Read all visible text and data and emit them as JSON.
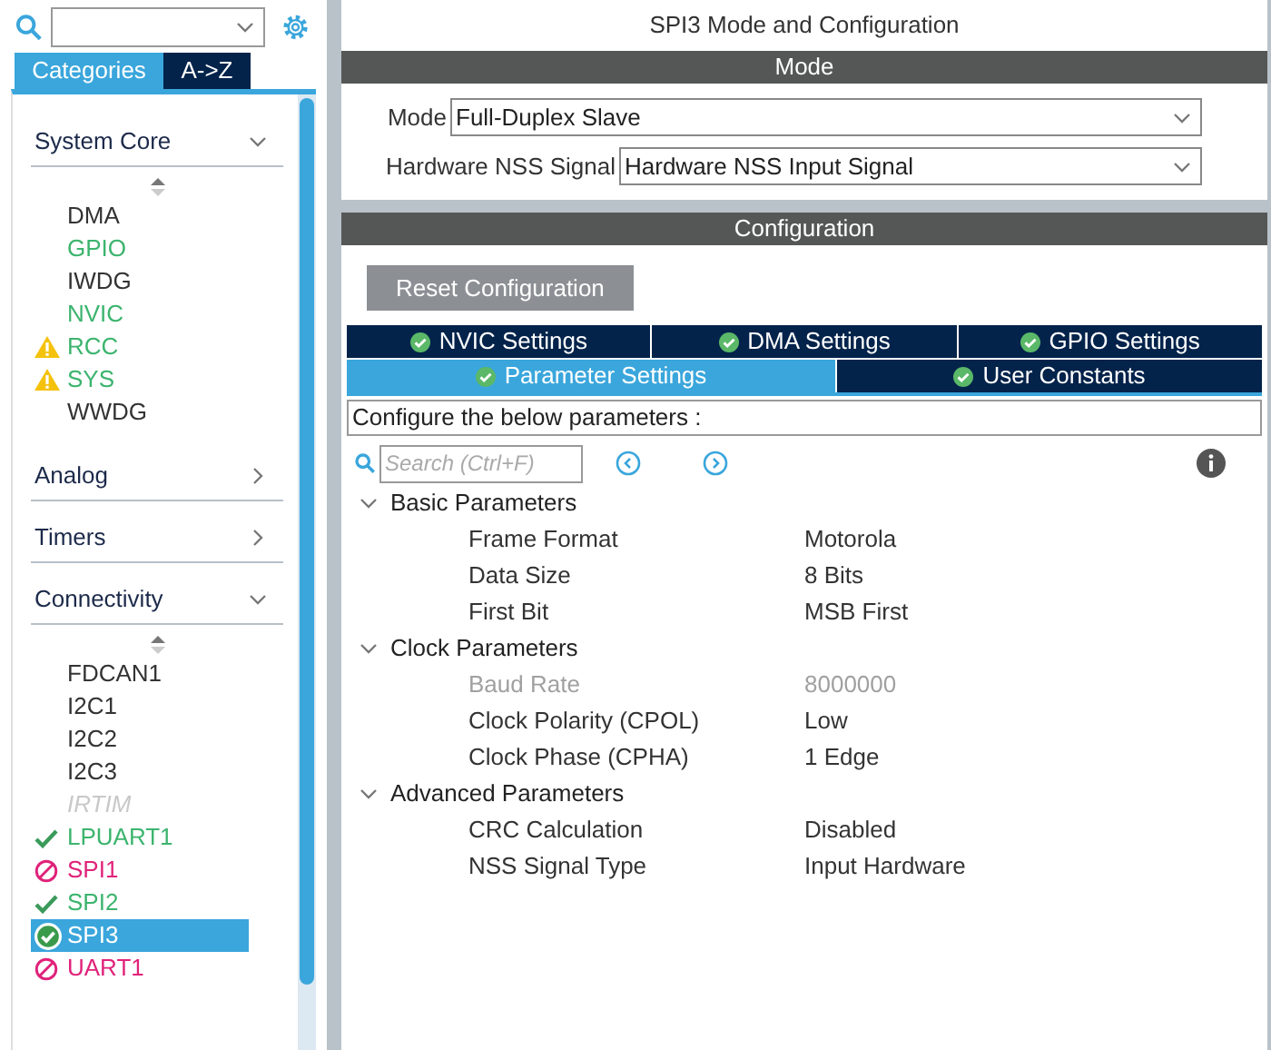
{
  "sidebar": {
    "view_tabs": [
      {
        "label": "Categories",
        "selected": true
      },
      {
        "label": "A->Z",
        "selected": false
      }
    ],
    "categories": [
      {
        "label": "System Core",
        "expanded": true,
        "items": [
          {
            "label": "DMA",
            "kind": "none",
            "selected": false
          },
          {
            "label": "GPIO",
            "kind": "configured",
            "selected": false
          },
          {
            "label": "IWDG",
            "kind": "none",
            "selected": false
          },
          {
            "label": "NVIC",
            "kind": "configured",
            "selected": false
          },
          {
            "label": "RCC",
            "kind": "warning",
            "selected": false
          },
          {
            "label": "SYS",
            "kind": "warning",
            "selected": false
          },
          {
            "label": "WWDG",
            "kind": "none",
            "selected": false
          }
        ]
      },
      {
        "label": "Analog",
        "expanded": false
      },
      {
        "label": "Timers",
        "expanded": false
      },
      {
        "label": "Connectivity",
        "expanded": true,
        "items": [
          {
            "label": "FDCAN1",
            "kind": "none",
            "selected": false
          },
          {
            "label": "I2C1",
            "kind": "none",
            "selected": false
          },
          {
            "label": "I2C2",
            "kind": "none",
            "selected": false
          },
          {
            "label": "I2C3",
            "kind": "none",
            "selected": false
          },
          {
            "label": "IRTIM",
            "kind": "disabled",
            "selected": false
          },
          {
            "label": "LPUART1",
            "kind": "ok",
            "selected": false
          },
          {
            "label": "SPI1",
            "kind": "error",
            "selected": false
          },
          {
            "label": "SPI2",
            "kind": "ok",
            "selected": false
          },
          {
            "label": "SPI3",
            "kind": "ok",
            "selected": true
          },
          {
            "label": "UART1",
            "kind": "error",
            "selected": false
          }
        ]
      }
    ]
  },
  "main": {
    "title": "SPI3 Mode and Configuration",
    "mode_header": "Mode",
    "mode_fields": [
      {
        "label": "Mode",
        "value": "Full-Duplex Slave"
      },
      {
        "label": "Hardware NSS Signal",
        "value": "Hardware NSS Input Signal"
      }
    ],
    "config_header": "Configuration",
    "reset_button": "Reset Configuration",
    "tab_rows": [
      [
        {
          "label": "NVIC Settings",
          "selected": false
        },
        {
          "label": "DMA Settings",
          "selected": false
        },
        {
          "label": "GPIO Settings",
          "selected": false
        }
      ],
      [
        {
          "label": "Parameter Settings",
          "selected": true
        },
        {
          "label": "User Constants",
          "selected": false
        }
      ]
    ],
    "hint": "Configure the below parameters :",
    "search": {
      "placeholder": "Search (Ctrl+F)"
    },
    "groups": [
      {
        "label": "Basic Parameters",
        "expanded": true,
        "rows": [
          {
            "name": "Frame Format",
            "value": "Motorola",
            "disabled": false
          },
          {
            "name": "Data Size",
            "value": "8 Bits",
            "disabled": false
          },
          {
            "name": "First Bit",
            "value": "MSB First",
            "disabled": false
          }
        ]
      },
      {
        "label": "Clock Parameters",
        "expanded": true,
        "rows": [
          {
            "name": "Baud Rate",
            "value": "8000000",
            "disabled": true
          },
          {
            "name": "Clock Polarity (CPOL)",
            "value": "Low",
            "disabled": false
          },
          {
            "name": "Clock Phase (CPHA)",
            "value": "1 Edge",
            "disabled": false
          }
        ]
      },
      {
        "label": "Advanced Parameters",
        "expanded": true,
        "rows": [
          {
            "name": "CRC Calculation",
            "value": "Disabled",
            "disabled": false
          },
          {
            "name": "NSS Signal Type",
            "value": "Input Hardware",
            "disabled": false
          }
        ]
      }
    ]
  }
}
